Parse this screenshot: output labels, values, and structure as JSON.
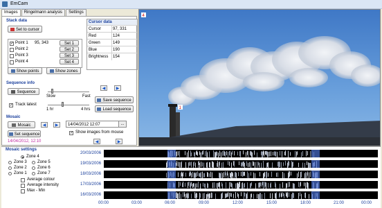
{
  "window": {
    "title": "EmCam"
  },
  "tabs": [
    "Images",
    "Ringelmann analysis",
    "Settings"
  ],
  "stack": {
    "heading": "Stack data",
    "set_to_cursor": "Set to cursor",
    "points": [
      {
        "label": "Point 1",
        "value": "95, 343",
        "checked": true,
        "set": "Set 1"
      },
      {
        "label": "Point 2",
        "value": "",
        "checked": false,
        "set": "Set 2"
      },
      {
        "label": "Point 3",
        "value": "",
        "checked": false,
        "set": "Set 3"
      },
      {
        "label": "Point 4",
        "value": "",
        "checked": false,
        "set": "Set 4"
      }
    ],
    "show_points": "Show points",
    "show_zones": "Show zones"
  },
  "cursor": {
    "heading": "Cursor data",
    "rows": [
      {
        "k": "Cursor",
        "v": "97, 331"
      },
      {
        "k": "Red",
        "v": "124"
      },
      {
        "k": "Green",
        "v": "149"
      },
      {
        "k": "Blue",
        "v": "190"
      },
      {
        "k": "Brightness",
        "v": "154"
      }
    ]
  },
  "sequence": {
    "heading": "Sequence info",
    "sequence_btn": "Sequence",
    "slow": "Slow",
    "fast": "Fast",
    "track_latest": "Track latest",
    "hr1": "1 hr",
    "hr4": "4 hrs",
    "save": "Save sequence",
    "load": "Load sequence",
    "speed_level": 0.1,
    "track_level": 0.35
  },
  "mosaic": {
    "heading": "Mosaic",
    "mosaic_btn": "Mosaic",
    "date_value": "14/04/2012 12:07",
    "date_btn": "...",
    "show_images": "Show images from mouse",
    "set_sequence": "Set sequence",
    "current": "14/04/2012, 12:10"
  },
  "mosaic_settings": {
    "heading": "Mosaic settings",
    "zones": [
      "Zone 4",
      "Zone 3",
      "Zone 5",
      "Zone 2",
      "Zone 6",
      "Zone 1",
      "Zone 7"
    ],
    "selected_zone": "Zone 4",
    "options": [
      "Average colour",
      "Average intensity",
      "Max - Min"
    ]
  },
  "timeline": {
    "dates": [
      "20/03/2006",
      "19/03/2006",
      "18/03/2006",
      "17/03/2006",
      "16/03/2006"
    ],
    "ticks": [
      "00:00",
      "03:00",
      "06:00",
      "09:00",
      "12:00",
      "15:00",
      "18:00",
      "21:00",
      "00:00"
    ]
  },
  "photo": {
    "marker_top": "4",
    "marker_stack": "1"
  }
}
